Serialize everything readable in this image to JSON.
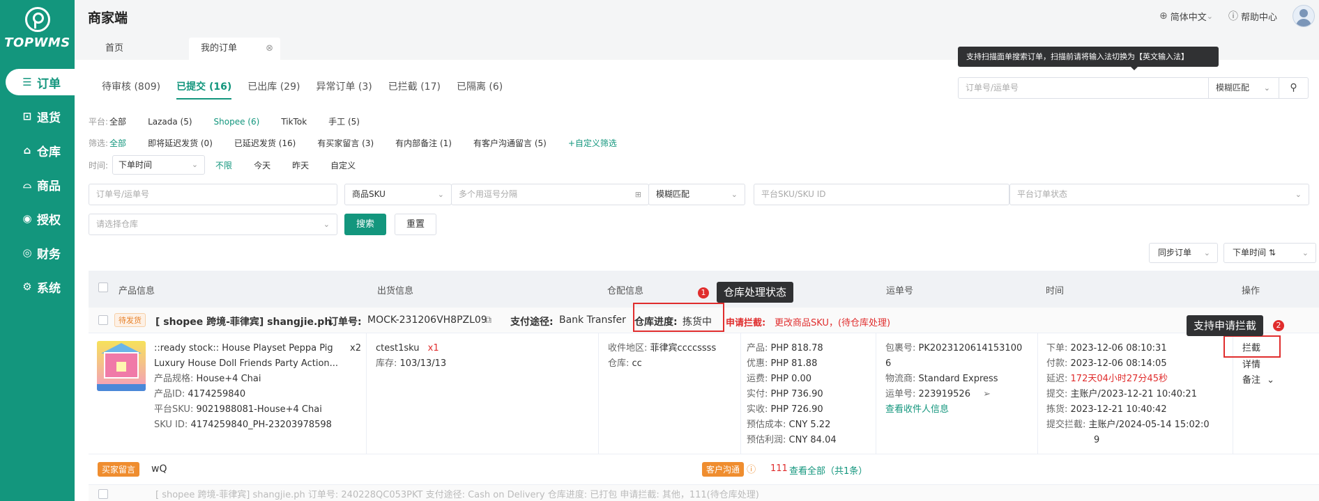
{
  "sidebar": {
    "logo_text": "TOPWMS",
    "items": [
      {
        "label": "订单",
        "icon": "order-icon",
        "active": true
      },
      {
        "label": "退货",
        "icon": "return-icon"
      },
      {
        "label": "仓库",
        "icon": "warehouse-icon"
      },
      {
        "label": "商品",
        "icon": "goods-icon"
      },
      {
        "label": "授权",
        "icon": "auth-icon"
      },
      {
        "label": "财务",
        "icon": "finance-icon"
      },
      {
        "label": "系统",
        "icon": "system-icon"
      }
    ]
  },
  "header": {
    "title": "商家端",
    "language": "简体中文",
    "help": "帮助中心"
  },
  "page_tabs": {
    "home": "首页",
    "orders": "我的订单"
  },
  "status_tabs": [
    {
      "label": "待审核 (809)"
    },
    {
      "label": "已提交 (16)",
      "active": true
    },
    {
      "label": "已出库 (29)"
    },
    {
      "label": "异常订单 (3)"
    },
    {
      "label": "已拦截 (17)"
    },
    {
      "label": "已隔离 (6)"
    }
  ],
  "scan_tip": "支持扫描面单搜索订单，扫描前请将输入法切换为【英文输入法】",
  "top_search": {
    "placeholder": "订单号/运单号",
    "mode": "模糊匹配"
  },
  "filters": {
    "platform_label": "平台:",
    "platforms": [
      "全部",
      "Lazada (5)",
      "Shopee (6)",
      "TikTok",
      "手工 (5)"
    ],
    "filter_label": "筛选:",
    "filter_options": [
      "全部",
      "即将延迟发货 (0)",
      "已延迟发货 (16)",
      "有买家留言 (3)",
      "有内部备注 (1)",
      "有客户沟通留言 (5)"
    ],
    "custom_filter": "+自定义筛选",
    "time_label": "时间:",
    "time_select": "下单时间",
    "time_options": [
      "不限",
      "今天",
      "昨天",
      "自定义"
    ]
  },
  "search_row": {
    "order_placeholder": "订单号/运单号",
    "sku_select": "商品SKU",
    "sku_placeholder": "多个用逗号分隔",
    "match_select": "模糊匹配",
    "platform_sku_placeholder": "平台SKU/SKU ID",
    "platform_status_placeholder": "平台订单状态",
    "warehouse_placeholder": "请选择仓库",
    "search_btn": "搜索",
    "reset_btn": "重置"
  },
  "actions": {
    "sync_orders": "同步订单",
    "sort": "下单时间"
  },
  "table_headers": {
    "product": "产品信息",
    "shipping": "出货信息",
    "warehouse": "仓配信息",
    "tracking": "运单号",
    "time": "时间",
    "ops": "操作"
  },
  "order": {
    "status": "待发货",
    "shop": "[ shopee 跨境-菲律宾]  shangjie.ph",
    "order_no_label": "订单号:",
    "order_no": "MOCK-231206VH8PZL09",
    "pay_label": "支付途径:",
    "pay": "Bank Transfer",
    "progress_label": "仓库进度:",
    "progress": "拣货中",
    "intercept_label": "申请拦截:",
    "intercept": "更改商品SKU，(待仓库处理)",
    "product": {
      "title_line1": "::ready stock:: House Playset Peppa Pig",
      "title_line2": "Luxury House Doll Friends Party Action...",
      "qty": "x2",
      "spec_label": "产品规格:",
      "spec": "House+4 Chai",
      "id_label": "产品ID:",
      "id": "4174259840",
      "psku_label": "平台SKU:",
      "psku": "9021988081-House+4 Chai",
      "skuid_label": "SKU ID:",
      "skuid": "4174259840_PH-23203978598"
    },
    "shipping": {
      "sku": "ctest1sku",
      "qty": "x1",
      "stock_label": "库存:",
      "stock": "103/13/13"
    },
    "warehouse": {
      "region_label": "收件地区:",
      "region": "菲律宾ccccssss",
      "wh_label": "仓库:",
      "wh": "cc"
    },
    "amounts": [
      {
        "k": "产品:",
        "v": "PHP 818.78"
      },
      {
        "k": "优惠:",
        "v": "PHP 81.88"
      },
      {
        "k": "运费:",
        "v": "PHP 0.00"
      },
      {
        "k": "实付:",
        "v": "PHP 736.90"
      },
      {
        "k": "实收:",
        "v": "PHP 726.90"
      },
      {
        "k": "预估成本:",
        "v": "CNY 5.22"
      },
      {
        "k": "预估利润:",
        "v": "CNY 84.04"
      }
    ],
    "tracking": {
      "pkg_label": "包裹号:",
      "pkg_line1": "PK2023120614153100",
      "pkg_line2": "6",
      "carrier_label": "物流商:",
      "carrier": "Standard Express",
      "waybill_label": "运单号:",
      "waybill": "223919526",
      "view_recipient": "查看收件人信息"
    },
    "times": [
      {
        "k": "下单:",
        "v": "2023-12-06 08:10:31"
      },
      {
        "k": "付款:",
        "v": "2023-12-06 08:14:05"
      },
      {
        "k": "延迟:",
        "v": "172天04小时27分45秒",
        "red": true
      },
      {
        "k": "提交:",
        "v": "主账户/2023-12-21 10:40:21"
      },
      {
        "k": "拣货:",
        "v": "2023-12-21 10:40:42"
      },
      {
        "k": "提交拦截:",
        "v": "主账户/2024-05-14 15:02:0"
      },
      {
        "k": "",
        "v": "9"
      }
    ],
    "ops": {
      "intercept": "拦截",
      "detail": "详情",
      "remark": "备注"
    },
    "buyer_msg_tag": "买家留言",
    "buyer_msg": "wQ",
    "cust_comm_tag": "客户沟通",
    "cust_comm_count": "111",
    "view_all": "查看全部（共1条）"
  },
  "next_order": {
    "text": "[ shopee 跨境-菲律宾]  shangjie.ph   订单号: 240228QC053PKT   支付途径: Cash on Delivery   仓库进度: 已打包   申请拦截: 其他，111(待仓库处理)"
  },
  "annotations": {
    "tip1": "仓库处理状态",
    "tip1_num": "1",
    "tip2": "支持申请拦截",
    "tip2_num": "2"
  }
}
